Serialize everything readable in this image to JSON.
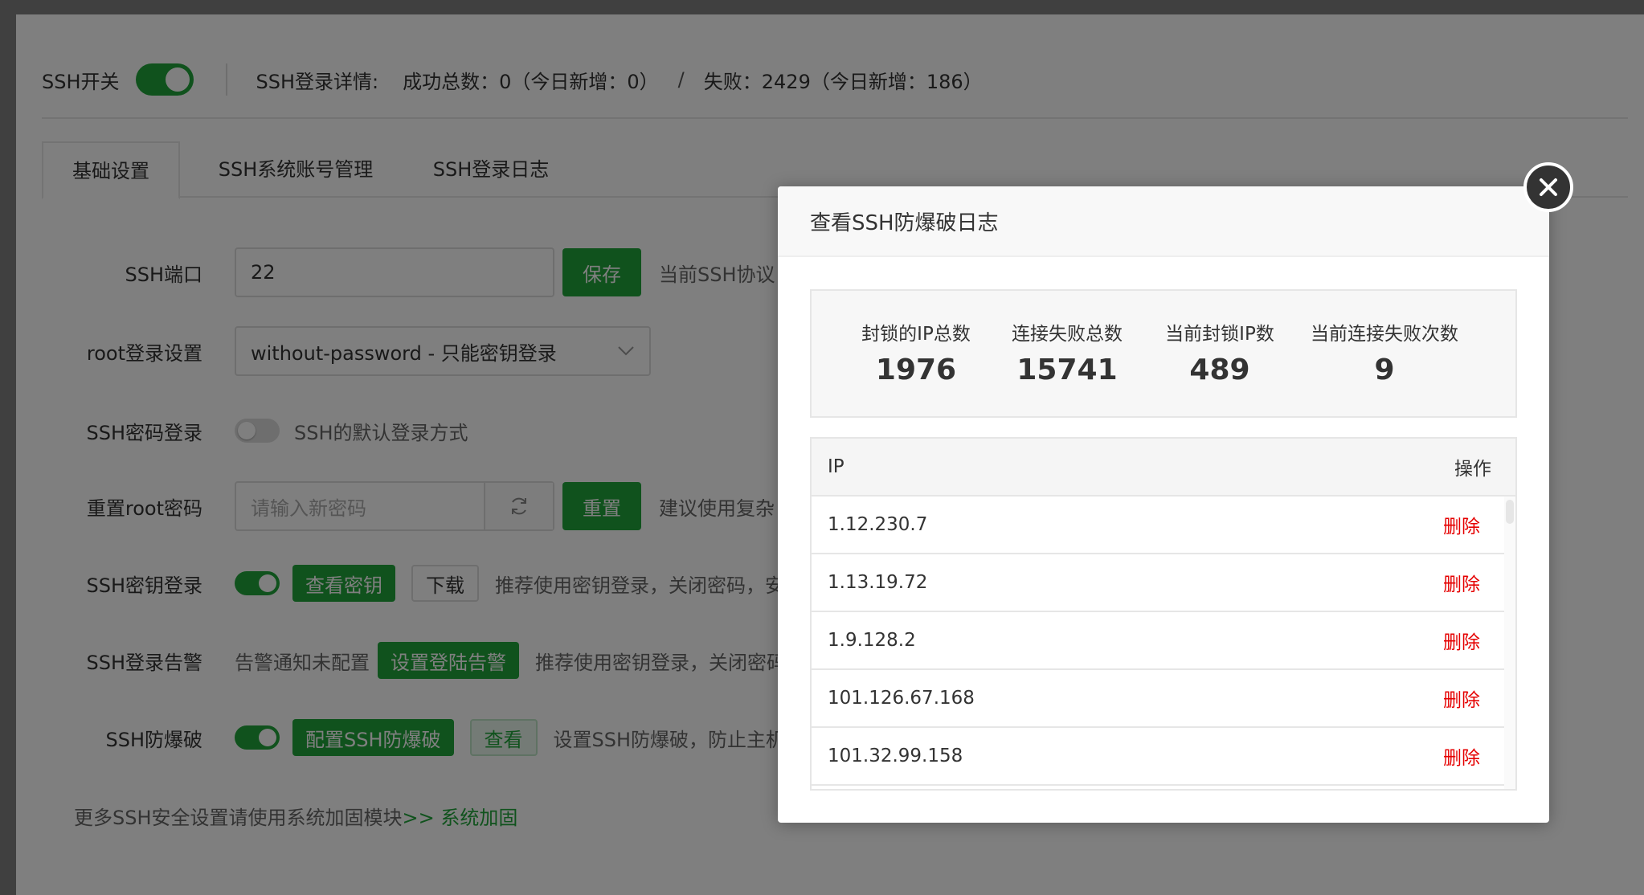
{
  "topbar": {
    "ssh_switch_label": "SSH开关",
    "ssh_login_detail_label": "SSH登录详情:",
    "success_text": "成功总数：0（今日新增：0）",
    "divider": "/",
    "fail_text": "失败：2429（今日新增：186）"
  },
  "tabs": [
    {
      "label": "基础设置",
      "active": true
    },
    {
      "label": "SSH系统账号管理",
      "active": false
    },
    {
      "label": "SSH登录日志",
      "active": false
    }
  ],
  "form": {
    "port": {
      "label": "SSH端口",
      "value": "22",
      "save": "保存",
      "hint": "当前SSH协议"
    },
    "root_login": {
      "label": "root登录设置",
      "value": "without-password - 只能密钥登录"
    },
    "password_login": {
      "label": "SSH密码登录",
      "hint": "SSH的默认登录方式"
    },
    "reset_root": {
      "label": "重置root密码",
      "placeholder": "请输入新密码",
      "reset": "重置",
      "hint": "建议使用复杂"
    },
    "key_login": {
      "label": "SSH密钥登录",
      "view_key": "查看密钥",
      "download": "下载",
      "hint": "推荐使用密钥登录，关闭密码，安"
    },
    "login_alert": {
      "label": "SSH登录告警",
      "status": "告警通知未配置",
      "set_alert": "设置登陆告警",
      "hint": "推荐使用密钥登录，关闭密码"
    },
    "brute_force": {
      "label": "SSH防爆破",
      "config": "配置SSH防爆破",
      "view": "查看",
      "hint": "设置SSH防爆破，防止主机"
    }
  },
  "footer": {
    "text": "更多SSH安全设置请使用系统加固模块",
    "link": ">> 系统加固"
  },
  "modal": {
    "title": "查看SSH防爆破日志",
    "stats": [
      {
        "label": "封锁的IP总数",
        "value": "1976"
      },
      {
        "label": "连接失败总数",
        "value": "15741"
      },
      {
        "label": "当前封锁IP数",
        "value": "489"
      },
      {
        "label": "当前连接失败次数",
        "value": "9"
      }
    ],
    "table": {
      "col_ip": "IP",
      "col_action": "操作",
      "rows": [
        {
          "ip": "1.12.230.7",
          "action": "删除"
        },
        {
          "ip": "1.13.19.72",
          "action": "删除"
        },
        {
          "ip": "1.9.128.2",
          "action": "删除"
        },
        {
          "ip": "101.126.67.168",
          "action": "删除"
        },
        {
          "ip": "101.32.99.158",
          "action": "删除"
        }
      ]
    }
  },
  "colors": {
    "brand_green": "#20a53a",
    "danger_red": "#e50000",
    "warn_orange": "#f0ad4e"
  }
}
